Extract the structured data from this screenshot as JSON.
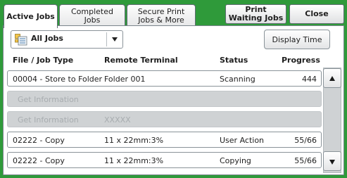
{
  "tabs": {
    "active_jobs": "Active Jobs",
    "completed_jobs": "Completed\nJobs",
    "secure_print": "Secure Print\nJobs & More",
    "print_waiting": "Print\nWaiting Jobs",
    "close": "Close"
  },
  "filter": {
    "selected": "All Jobs",
    "icon": "job-list-icon"
  },
  "display_time_button": "Display Time",
  "columns": {
    "file_job_type": "File / Job Type",
    "remote_terminal": "Remote Terminal",
    "status": "Status",
    "progress": "Progress"
  },
  "jobs": [
    {
      "type": "00004 - Store to Folder",
      "terminal": "Folder 001",
      "status": "Scanning",
      "progress": "444"
    },
    {
      "type": "Get Information",
      "terminal": "",
      "status": "",
      "progress": ""
    },
    {
      "type": "Get Information",
      "terminal": "XXXXX",
      "status": "",
      "progress": ""
    },
    {
      "type": "02222 - Copy",
      "terminal": "11 x 22mm:3%",
      "status": "User Action",
      "progress": "55/66"
    },
    {
      "type": "02222 - Copy",
      "terminal": "11 x 22mm:3%",
      "status": "Copying",
      "progress": "55/66"
    }
  ],
  "colors": {
    "background": "#2f9a3a",
    "panel": "#ffffff",
    "disabled_row": "#cfd2d4"
  }
}
